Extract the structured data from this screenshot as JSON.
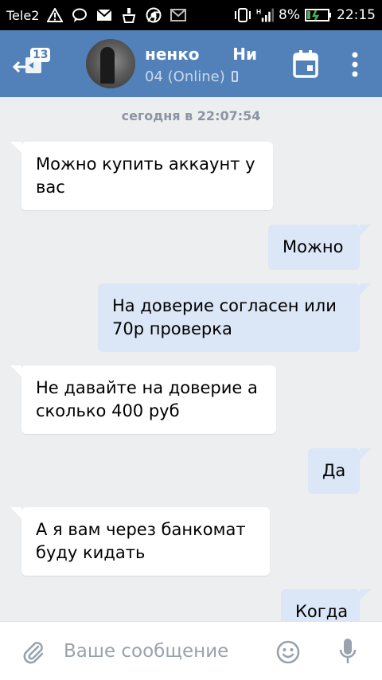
{
  "status_bar": {
    "carrier": "Tele2",
    "battery": "8%",
    "time": "22:15",
    "network": "H"
  },
  "header": {
    "unread_badge": "13",
    "name": "ненко      Ни",
    "status": "04 (Online)"
  },
  "chat": {
    "date_separator": "сегодня в 22:07:54",
    "messages": [
      {
        "direction": "in",
        "text": "Можно купить аккаунт у вас"
      },
      {
        "direction": "out",
        "text": "Можно"
      },
      {
        "direction": "out",
        "text": "На доверие согласен или 70р проверка"
      },
      {
        "direction": "in",
        "text": "Не давайте на доверие а сколько 400 руб"
      },
      {
        "direction": "out",
        "text": "Да"
      },
      {
        "direction": "in",
        "text": "А я вам через банкомат буду кидать"
      },
      {
        "direction": "out",
        "text": "Когда"
      }
    ]
  },
  "input": {
    "placeholder": "Ваше сообщение",
    "value": ""
  },
  "colors": {
    "header_bg": "#5181b8",
    "incoming_bubble": "#ffffff",
    "outgoing_bubble": "#dbe6f6",
    "chat_bg": "#edeef0"
  }
}
